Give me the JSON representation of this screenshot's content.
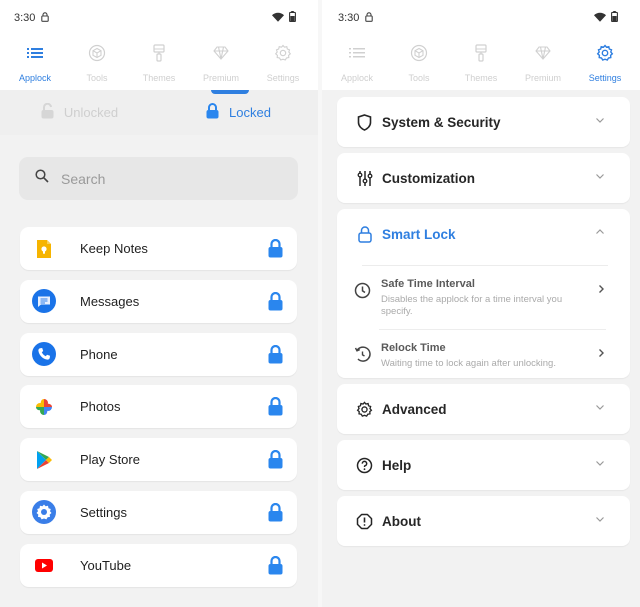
{
  "colors": {
    "accent": "#2f7fe0",
    "lock_blue": "#2a86ee",
    "inactive": "#cfcfcf",
    "background": "#f2f2f2"
  },
  "status_bar": {
    "time": "3:30",
    "icons": [
      "lock-icon",
      "wifi-icon",
      "battery-icon"
    ]
  },
  "nav": {
    "items": [
      {
        "label": "Applock",
        "icon": "list-icon"
      },
      {
        "label": "Tools",
        "icon": "cube-icon"
      },
      {
        "label": "Themes",
        "icon": "paint-roller-icon"
      },
      {
        "label": "Premium",
        "icon": "diamond-icon"
      },
      {
        "label": "Settings",
        "icon": "gear-icon"
      }
    ]
  },
  "left_screen": {
    "active_nav": "Applock",
    "segments": {
      "unlocked": "Unlocked",
      "locked": "Locked",
      "active": "Locked"
    },
    "search": {
      "placeholder": "Search",
      "value": ""
    },
    "apps": [
      {
        "name": "Keep Notes",
        "icon": "keep-notes-icon",
        "locked": true
      },
      {
        "name": "Messages",
        "icon": "messages-icon",
        "locked": true
      },
      {
        "name": "Phone",
        "icon": "phone-icon",
        "locked": true
      },
      {
        "name": "Photos",
        "icon": "photos-icon",
        "locked": true
      },
      {
        "name": "Play Store",
        "icon": "play-store-icon",
        "locked": true
      },
      {
        "name": "Settings",
        "icon": "settings-app-icon",
        "locked": true
      },
      {
        "name": "YouTube",
        "icon": "youtube-icon",
        "locked": true
      }
    ]
  },
  "right_screen": {
    "active_nav": "Settings",
    "sections": [
      {
        "title": "System & Security",
        "icon": "shield-icon",
        "expanded": false
      },
      {
        "title": "Customization",
        "icon": "sliders-icon",
        "expanded": false
      },
      {
        "title": "Smart Lock",
        "icon": "lock-outline-icon",
        "expanded": true,
        "items": [
          {
            "title": "Safe Time Interval",
            "description": "Disables the applock for a time interval you specify.",
            "icon": "clock-icon"
          },
          {
            "title": "Relock Time",
            "description": "Waiting time to lock again after unlocking.",
            "icon": "history-icon"
          }
        ]
      },
      {
        "title": "Advanced",
        "icon": "gear-icon",
        "expanded": false
      },
      {
        "title": "Help",
        "icon": "help-circle-icon",
        "expanded": false
      },
      {
        "title": "About",
        "icon": "info-octagon-icon",
        "expanded": false
      }
    ]
  }
}
